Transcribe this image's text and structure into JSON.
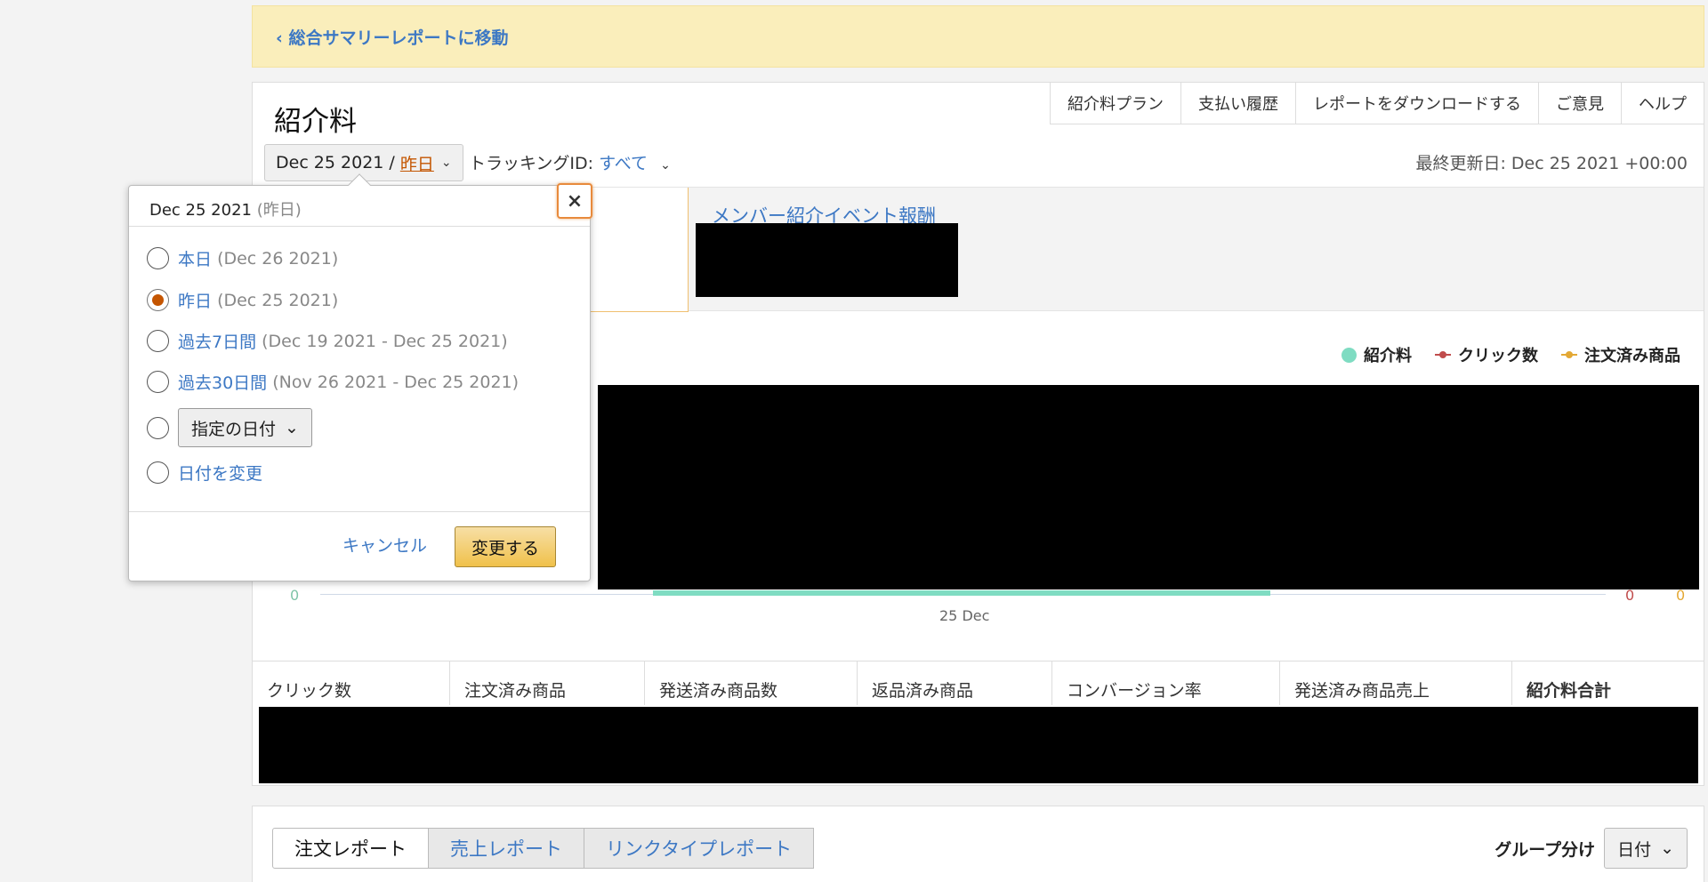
{
  "banner": {
    "back_link": "‹ 総合サマリーレポートに移動"
  },
  "page": {
    "title": "紹介料",
    "top_tabs": [
      "紹介料プラン",
      "支払い履歴",
      "レポートをダウンロードする",
      "ご意見",
      "ヘルプ"
    ],
    "date_selector": {
      "date": "Dec 25 2021 /",
      "selected": "昨日"
    },
    "tracking": {
      "label": "トラッキングID:",
      "value": "すべて"
    },
    "last_updated": "最終更新日: Dec 25 2021 +00:00",
    "member_event": "メンバー紹介イベント報酬"
  },
  "chart_data": {
    "type": "line",
    "x": [
      "25 Dec"
    ],
    "series": [
      {
        "name": "紹介料",
        "values": [
          0
        ]
      },
      {
        "name": "クリック数",
        "values": [
          0
        ]
      },
      {
        "name": "注文済み商品",
        "values": [
          0
        ]
      }
    ],
    "colors": [
      "#7fdcc2",
      "#c04c4c",
      "#e3a835"
    ],
    "legend_position": "top-right",
    "axis_ticks": {
      "left": "0",
      "right1": "0",
      "right2": "0"
    },
    "x_tick": "25 Dec"
  },
  "table": {
    "headers": [
      "クリック数",
      "注文済み商品",
      "発送済み商品数",
      "返品済み商品",
      "コンバージョン率",
      "発送済み商品売上",
      "紹介料合計"
    ]
  },
  "report_tabs": [
    "注文レポート",
    "売上レポート",
    "リンクタイプレポート"
  ],
  "group_by": {
    "label": "グループ分け",
    "value": "日付"
  },
  "popover": {
    "header_date": "Dec 25 2021",
    "header_note": "(昨日)",
    "options": [
      {
        "label": "本日",
        "range": "(Dec 26 2021)",
        "selected": false
      },
      {
        "label": "昨日",
        "range": "(Dec 25 2021)",
        "selected": true
      },
      {
        "label": "過去7日間",
        "range": "(Dec 19 2021 - Dec 25 2021)",
        "selected": false
      },
      {
        "label": "過去30日間",
        "range": "(Nov 26 2021 - Dec 25 2021)",
        "selected": false
      }
    ],
    "custom_select": "指定の日付",
    "change_date": "日付を変更",
    "cancel": "キャンセル",
    "apply": "変更する",
    "close": "×"
  }
}
